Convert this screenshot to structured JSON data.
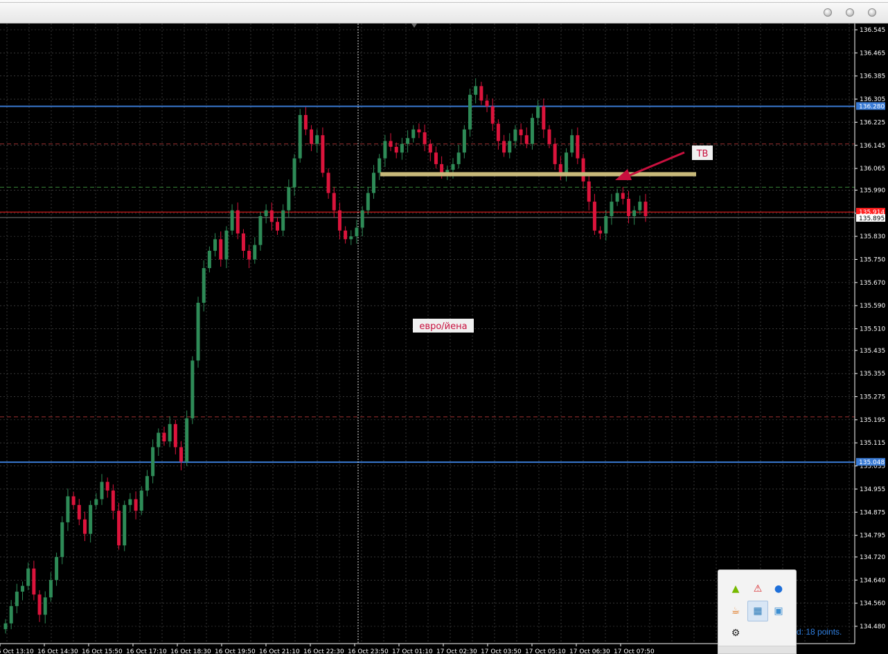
{
  "window": {
    "buttons": [
      "minimize",
      "maximize",
      "close"
    ]
  },
  "chart": {
    "symbol_label": "евро/йена",
    "annotation_label": "ТВ",
    "colors": {
      "background": "#000000",
      "grid": "#5a5a5a",
      "bull": "#2e8b57",
      "bear": "#dc143c",
      "support_line": "#3a7bd5",
      "zone": "#c8b97a",
      "arrow": "#c8103e",
      "bid_line": "#ff2020"
    },
    "price_axis_ticks": [
      "136.545",
      "136.465",
      "136.385",
      "136.305",
      "136.225",
      "136.145",
      "136.065",
      "135.990",
      "135.910",
      "135.830",
      "135.750",
      "135.670",
      "135.590",
      "135.510",
      "135.435",
      "135.355",
      "135.275",
      "135.195",
      "135.115",
      "135.035",
      "134.955",
      "134.875",
      "134.795",
      "134.720",
      "134.640",
      "134.560",
      "134.480"
    ],
    "price_axis_values": [
      136.545,
      136.465,
      136.385,
      136.305,
      136.225,
      136.145,
      136.065,
      135.99,
      135.91,
      135.83,
      135.75,
      135.67,
      135.59,
      135.51,
      135.435,
      135.355,
      135.275,
      135.195,
      135.115,
      135.035,
      134.955,
      134.875,
      134.795,
      134.72,
      134.64,
      134.56,
      134.48
    ],
    "time_axis_ticks": [
      "16 Oct 13:10",
      "16 Oct 14:30",
      "16 Oct 15:50",
      "16 Oct 17:10",
      "16 Oct 18:30",
      "16 Oct 19:50",
      "16 Oct 21:10",
      "16 Oct 22:30",
      "16 Oct 23:50",
      "17 Oct 01:10",
      "17 Oct 02:30",
      "17 Oct 03:50",
      "17 Oct 05:10",
      "17 Oct 06:30",
      "17 Oct 07:50"
    ],
    "horizontal_levels": [
      {
        "price": 136.28,
        "label": "136.280",
        "style": "solid",
        "color": "#3a7bd5"
      },
      {
        "price": 135.048,
        "label": "135.048",
        "style": "solid",
        "color": "#3a7bd5"
      },
      {
        "price": 136.15,
        "style": "dashed",
        "color": "#a03030"
      },
      {
        "price": 136.0,
        "style": "dashed",
        "color": "#3a8a3a"
      },
      {
        "price": 135.205,
        "style": "dashed",
        "color": "#a03030"
      }
    ],
    "bid": {
      "price": 135.914,
      "label": "135.914"
    },
    "last": {
      "price": 135.895,
      "label": "135.895"
    },
    "zone": {
      "price": 136.045
    },
    "closes": [
      134.49,
      134.55,
      134.6,
      134.62,
      134.68,
      134.59,
      134.52,
      134.58,
      134.64,
      134.72,
      134.84,
      134.93,
      134.9,
      134.85,
      134.8,
      134.9,
      134.92,
      134.98,
      134.95,
      134.88,
      134.76,
      134.9,
      134.92,
      134.88,
      134.95,
      135.0,
      135.1,
      135.15,
      135.12,
      135.18,
      135.1,
      135.05,
      135.2,
      135.4,
      135.6,
      135.72,
      135.78,
      135.82,
      135.75,
      135.85,
      135.92,
      135.84,
      135.78,
      135.75,
      135.8,
      135.9,
      135.92,
      135.88,
      135.85,
      135.92,
      136.0,
      136.1,
      136.25,
      136.2,
      136.15,
      136.18,
      136.05,
      135.98,
      135.92,
      135.85,
      135.82,
      135.83,
      135.86,
      135.92,
      135.98,
      136.05,
      136.1,
      136.16,
      136.14,
      136.12,
      136.15,
      136.17,
      136.2,
      136.19,
      136.15,
      136.12,
      136.08,
      136.05,
      136.06,
      136.08,
      136.12,
      136.2,
      136.32,
      136.35,
      136.3,
      136.28,
      136.22,
      136.16,
      136.12,
      136.16,
      136.2,
      136.18,
      136.15,
      136.24,
      136.28,
      136.2,
      136.15,
      136.08,
      136.05,
      136.12,
      136.18,
      136.1,
      136.02,
      135.95,
      135.85,
      135.84,
      135.9,
      135.95,
      135.98,
      135.96,
      135.9,
      135.92,
      135.95,
      135.9
    ],
    "window_clock": ""
  },
  "tray": {
    "icons": [
      "nvidia-icon",
      "alert-icon",
      "network-icon",
      "java-icon",
      "selected-app-icon",
      "monitor-icon",
      "wrench-icon"
    ]
  },
  "status": {
    "text": "d: 18 points."
  }
}
